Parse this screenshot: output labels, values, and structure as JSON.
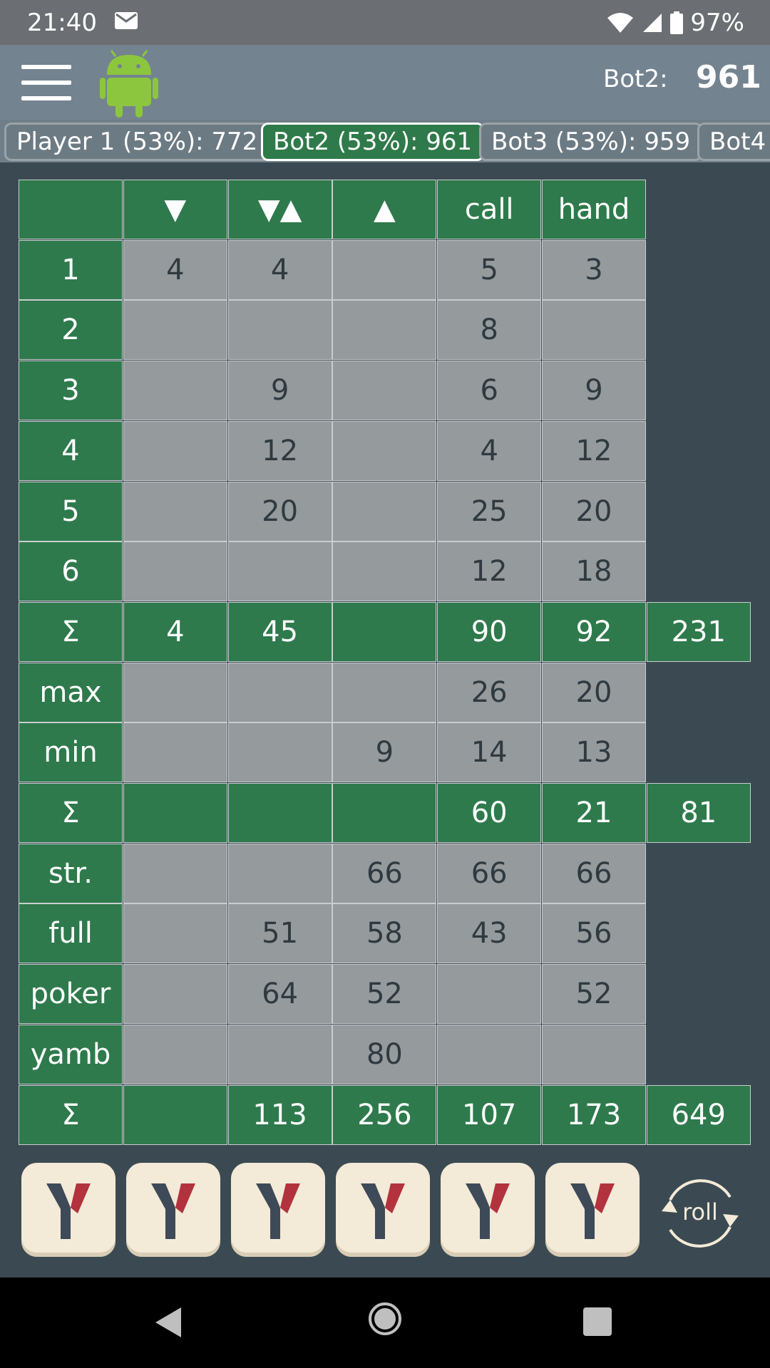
{
  "status_bar": {
    "time": "21:40",
    "battery": "97%"
  },
  "app_bar": {
    "score_label": "Bot2:",
    "score_value": "961"
  },
  "tabs": [
    {
      "label": "Player 1 (53%): 772"
    },
    {
      "label": "Bot2 (53%): 961"
    },
    {
      "label": "Bot3 (53%): 959"
    },
    {
      "label": "Bot4"
    }
  ],
  "table": {
    "columns": [
      "▼",
      "▼▲",
      "▲",
      "call",
      "hand"
    ],
    "rows": [
      {
        "label": "1",
        "values": [
          "4",
          "4",
          "",
          "5",
          "3"
        ]
      },
      {
        "label": "2",
        "values": [
          "",
          "",
          "",
          "8",
          ""
        ]
      },
      {
        "label": "3",
        "values": [
          "",
          "9",
          "",
          "6",
          "9"
        ]
      },
      {
        "label": "4",
        "values": [
          "",
          "12",
          "",
          "4",
          "12"
        ]
      },
      {
        "label": "5",
        "values": [
          "",
          "20",
          "",
          "25",
          "20"
        ]
      },
      {
        "label": "6",
        "values": [
          "",
          "",
          "",
          "12",
          "18"
        ]
      },
      {
        "label": "Σ",
        "values": [
          "4",
          "45",
          "",
          "90",
          "92"
        ],
        "total": "231",
        "sum": true
      },
      {
        "label": "max",
        "values": [
          "",
          "",
          "",
          "26",
          "20"
        ]
      },
      {
        "label": "min",
        "values": [
          "",
          "",
          "9",
          "14",
          "13"
        ]
      },
      {
        "label": "Σ",
        "values": [
          "",
          "",
          "",
          "60",
          "21"
        ],
        "total": "81",
        "sum": true
      },
      {
        "label": "str.",
        "values": [
          "",
          "",
          "66",
          "66",
          "66"
        ]
      },
      {
        "label": "full",
        "values": [
          "",
          "51",
          "58",
          "43",
          "56"
        ]
      },
      {
        "label": "poker",
        "values": [
          "",
          "64",
          "52",
          "",
          "52"
        ]
      },
      {
        "label": "yamb",
        "values": [
          "",
          "",
          "80",
          "",
          ""
        ]
      },
      {
        "label": "Σ",
        "values": [
          "",
          "113",
          "256",
          "107",
          "173"
        ],
        "total": "649",
        "sum": true
      }
    ]
  },
  "dice": [
    "Y",
    "Y",
    "Y",
    "Y",
    "Y",
    "Y"
  ],
  "roll_label": "roll"
}
